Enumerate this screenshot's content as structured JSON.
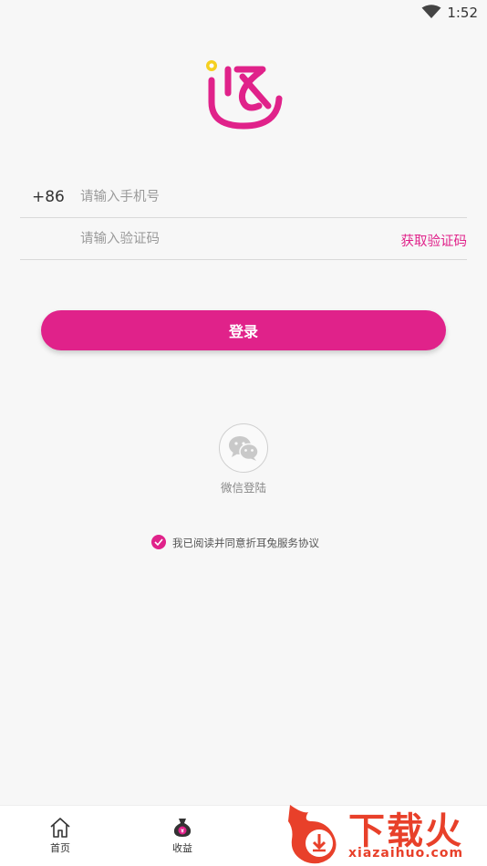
{
  "status_bar": {
    "time": "1:52",
    "icon": "wifi-icon"
  },
  "logo": {
    "icon": "app-logo-icon",
    "color": "#e0228a",
    "accent": "#f5d020"
  },
  "login_form": {
    "country_code": "+86",
    "phone_placeholder": "请输入手机号",
    "code_placeholder": "请输入验证码",
    "get_code_label": "获取验证码",
    "login_label": "登录"
  },
  "social_login": {
    "icon": "wechat-icon",
    "label": "微信登陆"
  },
  "agreement": {
    "checked": true,
    "text": "我已阅读并同意折耳兔服务协议"
  },
  "bottom_nav": {
    "items": [
      {
        "icon": "home-icon",
        "label": "首页"
      },
      {
        "icon": "income-bag-icon",
        "label": "收益"
      }
    ]
  },
  "watermark": {
    "title": "下载火",
    "domain": "xiazaihuo.com"
  },
  "colors": {
    "accent": "#e0228a",
    "background": "#f7f7f7",
    "watermark": "#e8402a"
  }
}
